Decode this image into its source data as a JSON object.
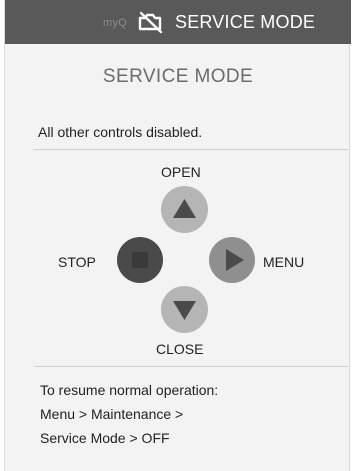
{
  "header": {
    "brand": "myQ",
    "status_icon": "wifi-off-icon",
    "mode_label": "SERVICE MODE"
  },
  "main": {
    "title": "SERVICE MODE",
    "message": "All other controls disabled.",
    "controls": {
      "open_label": "OPEN",
      "close_label": "CLOSE",
      "stop_label": "STOP",
      "menu_label": "MENU",
      "open_icon": "triangle-up-icon",
      "close_icon": "triangle-down-icon",
      "stop_icon": "stop-square-icon",
      "menu_icon": "play-right-icon"
    },
    "resume": {
      "line1": "To resume normal operation:",
      "line2": "Menu > Maintenance >",
      "line3": "Service Mode > OFF"
    }
  },
  "colors": {
    "header_bg": "#595959",
    "screen_bg": "#f3f3f3",
    "open_close_button": "#b5b5b5",
    "stop_button": "#4a4a4a",
    "menu_button": "#8f8f8f",
    "glyph": "#4a4a4a"
  }
}
